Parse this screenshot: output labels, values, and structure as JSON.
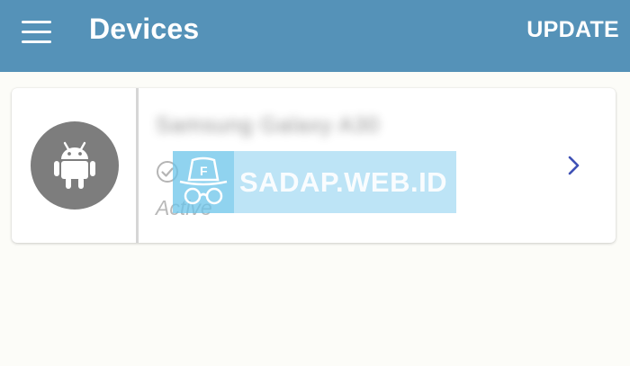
{
  "appbar": {
    "title": "Devices",
    "action_label": "UPDATE",
    "background_color": "#5592b8",
    "menu_icon": "hamburger-menu-icon"
  },
  "device_card": {
    "name": "Samsung Galaxy A30",
    "status": "Active",
    "avatar_icon": "android-icon",
    "status_icon": "check-circle-icon",
    "navigate_icon": "chevron-right-icon",
    "avatar_color": "#7d7d7d",
    "chevron_color": "#3f51b5"
  },
  "watermark": {
    "text": "SADAP.WEB.ID",
    "logo": "spy-hat-glasses-logo"
  }
}
